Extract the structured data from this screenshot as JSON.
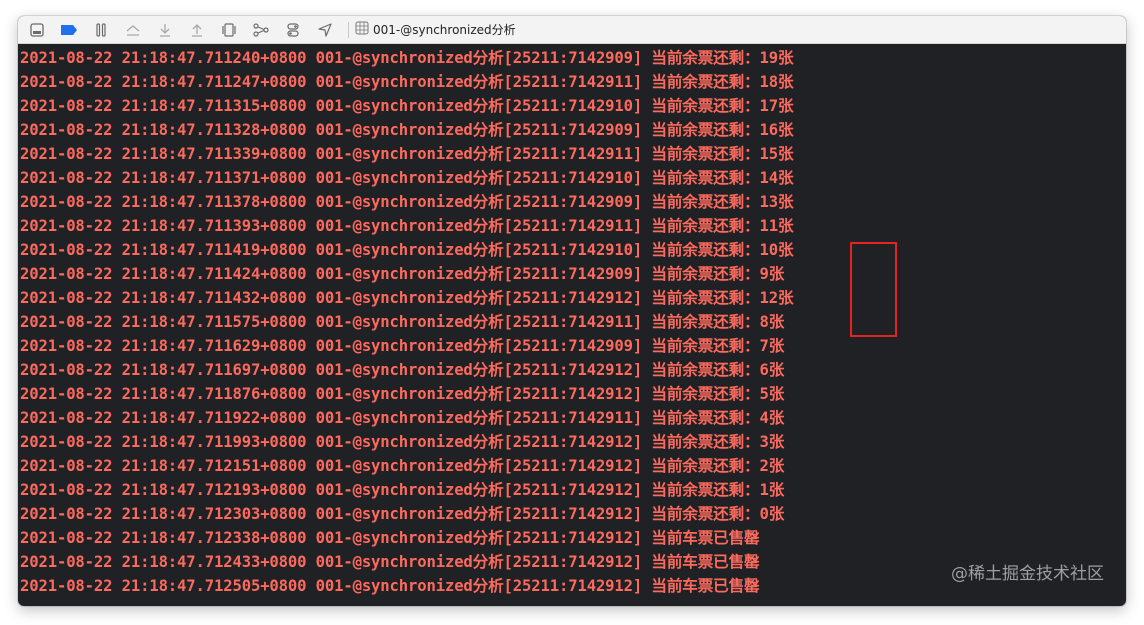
{
  "toolbar": {
    "buttons": [
      {
        "name": "hide-debug-area-icon"
      },
      {
        "name": "breakpoints-toggle-icon"
      },
      {
        "name": "pause-icon"
      },
      {
        "name": "step-over-icon"
      },
      {
        "name": "step-into-icon"
      },
      {
        "name": "step-out-icon"
      },
      {
        "name": "view-hierarchy-icon"
      },
      {
        "name": "memory-graph-icon"
      },
      {
        "name": "environment-overrides-icon"
      },
      {
        "name": "simulate-location-icon"
      }
    ],
    "breadcrumb": {
      "icon": "target-grid-icon",
      "label": "001-@synchronized分析"
    }
  },
  "console": {
    "text_color": "#fc6a5d",
    "lines": [
      "2021-08-22 21:18:47.711240+0800 001-@synchronized分析[25211:7142909] 当前余票还剩：19张",
      "2021-08-22 21:18:47.711247+0800 001-@synchronized分析[25211:7142911] 当前余票还剩：18张",
      "2021-08-22 21:18:47.711315+0800 001-@synchronized分析[25211:7142910] 当前余票还剩：17张",
      "2021-08-22 21:18:47.711328+0800 001-@synchronized分析[25211:7142909] 当前余票还剩：16张",
      "2021-08-22 21:18:47.711339+0800 001-@synchronized分析[25211:7142911] 当前余票还剩：15张",
      "2021-08-22 21:18:47.711371+0800 001-@synchronized分析[25211:7142910] 当前余票还剩：14张",
      "2021-08-22 21:18:47.711378+0800 001-@synchronized分析[25211:7142909] 当前余票还剩：13张",
      "2021-08-22 21:18:47.711393+0800 001-@synchronized分析[25211:7142911] 当前余票还剩：11张",
      "2021-08-22 21:18:47.711419+0800 001-@synchronized分析[25211:7142910] 当前余票还剩：10张",
      "2021-08-22 21:18:47.711424+0800 001-@synchronized分析[25211:7142909] 当前余票还剩：9张",
      "2021-08-22 21:18:47.711432+0800 001-@synchronized分析[25211:7142912] 当前余票还剩：12张",
      "2021-08-22 21:18:47.711575+0800 001-@synchronized分析[25211:7142911] 当前余票还剩：8张",
      "2021-08-22 21:18:47.711629+0800 001-@synchronized分析[25211:7142909] 当前余票还剩：7张",
      "2021-08-22 21:18:47.711697+0800 001-@synchronized分析[25211:7142912] 当前余票还剩：6张",
      "2021-08-22 21:18:47.711876+0800 001-@synchronized分析[25211:7142912] 当前余票还剩：5张",
      "2021-08-22 21:18:47.711922+0800 001-@synchronized分析[25211:7142911] 当前余票还剩：4张",
      "2021-08-22 21:18:47.711993+0800 001-@synchronized分析[25211:7142912] 当前余票还剩：3张",
      "2021-08-22 21:18:47.712151+0800 001-@synchronized分析[25211:7142912] 当前余票还剩：2张",
      "2021-08-22 21:18:47.712193+0800 001-@synchronized分析[25211:7142912] 当前余票还剩：1张",
      "2021-08-22 21:18:47.712303+0800 001-@synchronized分析[25211:7142912] 当前余票还剩：0张",
      "2021-08-22 21:18:47.712338+0800 001-@synchronized分析[25211:7142912] 当前车票已售罄",
      "2021-08-22 21:18:47.712433+0800 001-@synchronized分析[25211:7142912] 当前车票已售罄",
      "2021-08-22 21:18:47.712505+0800 001-@synchronized分析[25211:7142912] 当前车票已售罄"
    ],
    "highlight_color": "#e32222"
  },
  "watermark": "@稀土掘金技术社区"
}
